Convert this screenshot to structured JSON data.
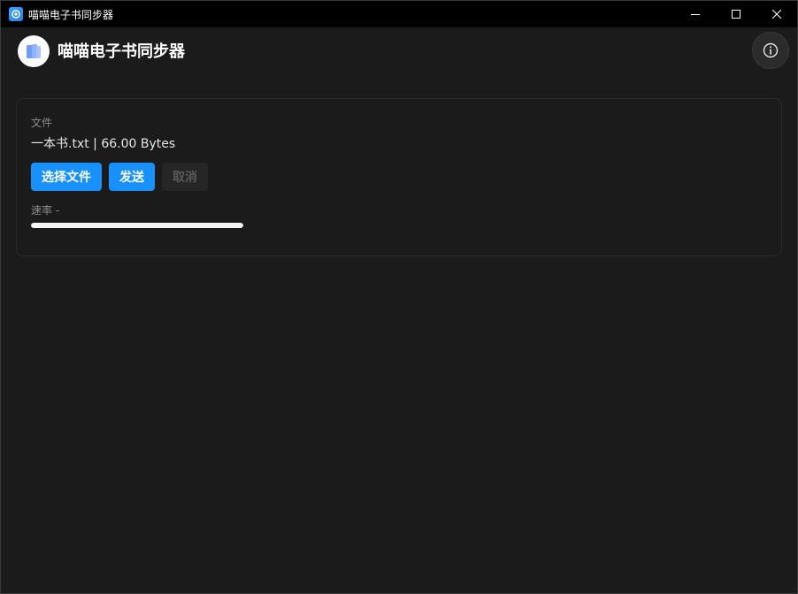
{
  "window": {
    "title": "喵喵电子书同步器"
  },
  "header": {
    "title": "喵喵电子书同步器"
  },
  "file_section": {
    "label": "文件",
    "file_info": "一本书.txt | 66.00 Bytes"
  },
  "actions": {
    "select_file": "选择文件",
    "send": "发送",
    "cancel": "取消"
  },
  "transfer": {
    "rate_label": "速率 -",
    "progress_fraction": 1.0
  },
  "colors": {
    "primary": "#1891ff",
    "background": "#1b1b1b",
    "titlebar": "#000000"
  },
  "icons": {
    "app": "book-app-icon",
    "info": "info-icon",
    "minimize": "minimize-icon",
    "maximize": "maximize-icon",
    "close": "close-icon"
  }
}
